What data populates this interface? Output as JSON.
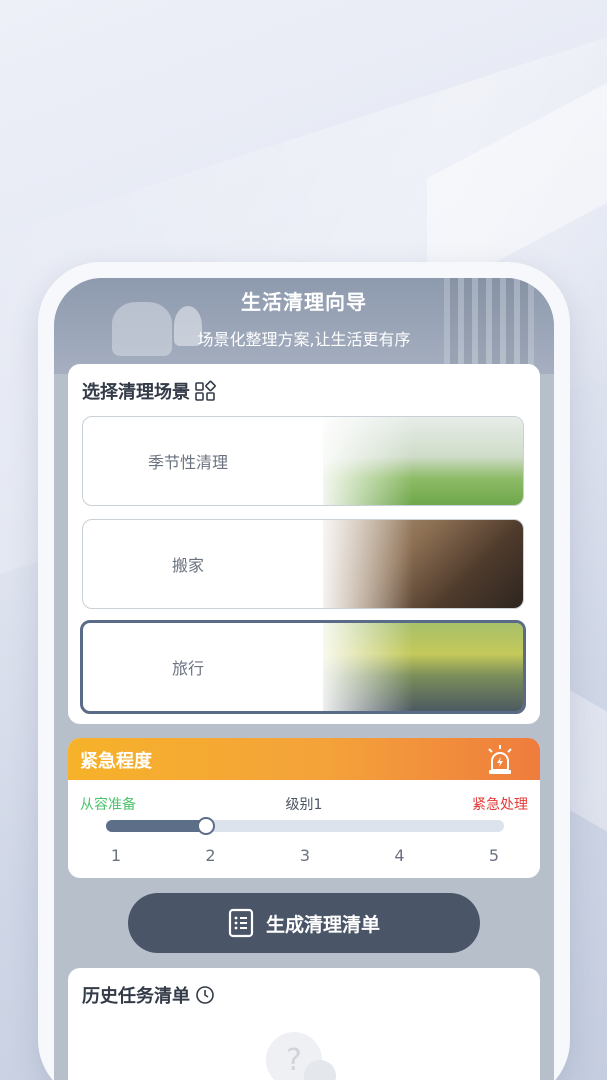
{
  "header": {
    "title": "生活清理向导",
    "subtitle": "场景化整理方案,让生活更有序"
  },
  "scene_section": {
    "title": "选择清理场景",
    "scenes": [
      {
        "label": "季节性清理",
        "selected": false
      },
      {
        "label": "搬家",
        "selected": false
      },
      {
        "label": "旅行",
        "selected": true
      }
    ]
  },
  "urgency": {
    "title": "紧急程度",
    "left_label": "从容准备",
    "current_label": "级别1",
    "right_label": "紧急处理",
    "level": 2,
    "max": 5,
    "ticks": [
      "1",
      "2",
      "3",
      "4",
      "5"
    ]
  },
  "generate_button": {
    "label": "生成清理清单"
  },
  "history": {
    "title": "历史任务清单"
  },
  "colors": {
    "primary_dark": "#4a5568",
    "urgency_start": "#f6b22a",
    "urgency_end": "#ef7c3d",
    "relaxed_green": "#4ec36c",
    "urgent_red": "#e53935"
  }
}
